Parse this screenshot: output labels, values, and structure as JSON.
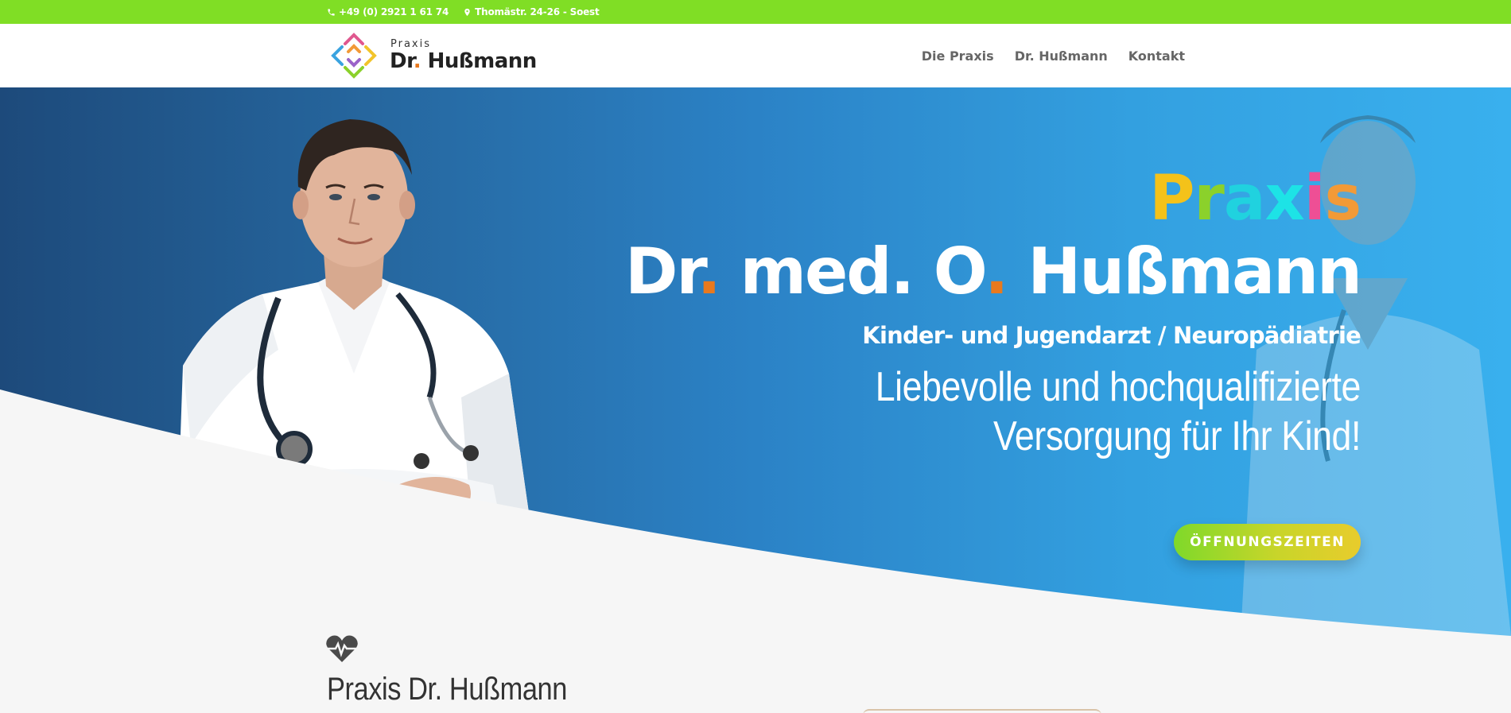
{
  "topbar": {
    "phone": "+49 (0) 2921 1 61 74",
    "address": "Thomästr. 24-26 - Soest",
    "phone_icon": "phone-icon",
    "address_icon": "map-pin-icon",
    "color": "#80de25"
  },
  "logo": {
    "small": "Praxis",
    "big_prefix": "Dr",
    "big_dot": ".",
    "big_suffix": " Hußmann"
  },
  "nav": {
    "items": [
      "Die Praxis",
      "Dr. Hußmann",
      "Kontakt"
    ]
  },
  "hero": {
    "praxis_letters": [
      {
        "char": "P",
        "color": "#f4c21a"
      },
      {
        "char": "r",
        "color": "#8bd12b"
      },
      {
        "char": "a",
        "color": "#20d2df"
      },
      {
        "char": "x",
        "color": "#1de3e6"
      },
      {
        "char": "i",
        "color": "#ee4f95"
      },
      {
        "char": "s",
        "color": "#f29a37"
      }
    ],
    "name_part1": "Dr",
    "name_dot1": ".",
    "name_part2": " med. O",
    "name_dot2": ".",
    "name_part3": " Hußmann",
    "subtitle": "Kinder- und Jugendarzt / Neuropädiatrie",
    "tagline_line1": "Liebevolle und hochqualifizierte",
    "tagline_line2": "Versorgung für Ihr Kind!",
    "cta_label": "ÖFFNUNGSZEITEN",
    "accent": "#e8791e"
  },
  "section": {
    "icon": "heartbeat-icon",
    "title": "Praxis Dr. Hußmann"
  }
}
